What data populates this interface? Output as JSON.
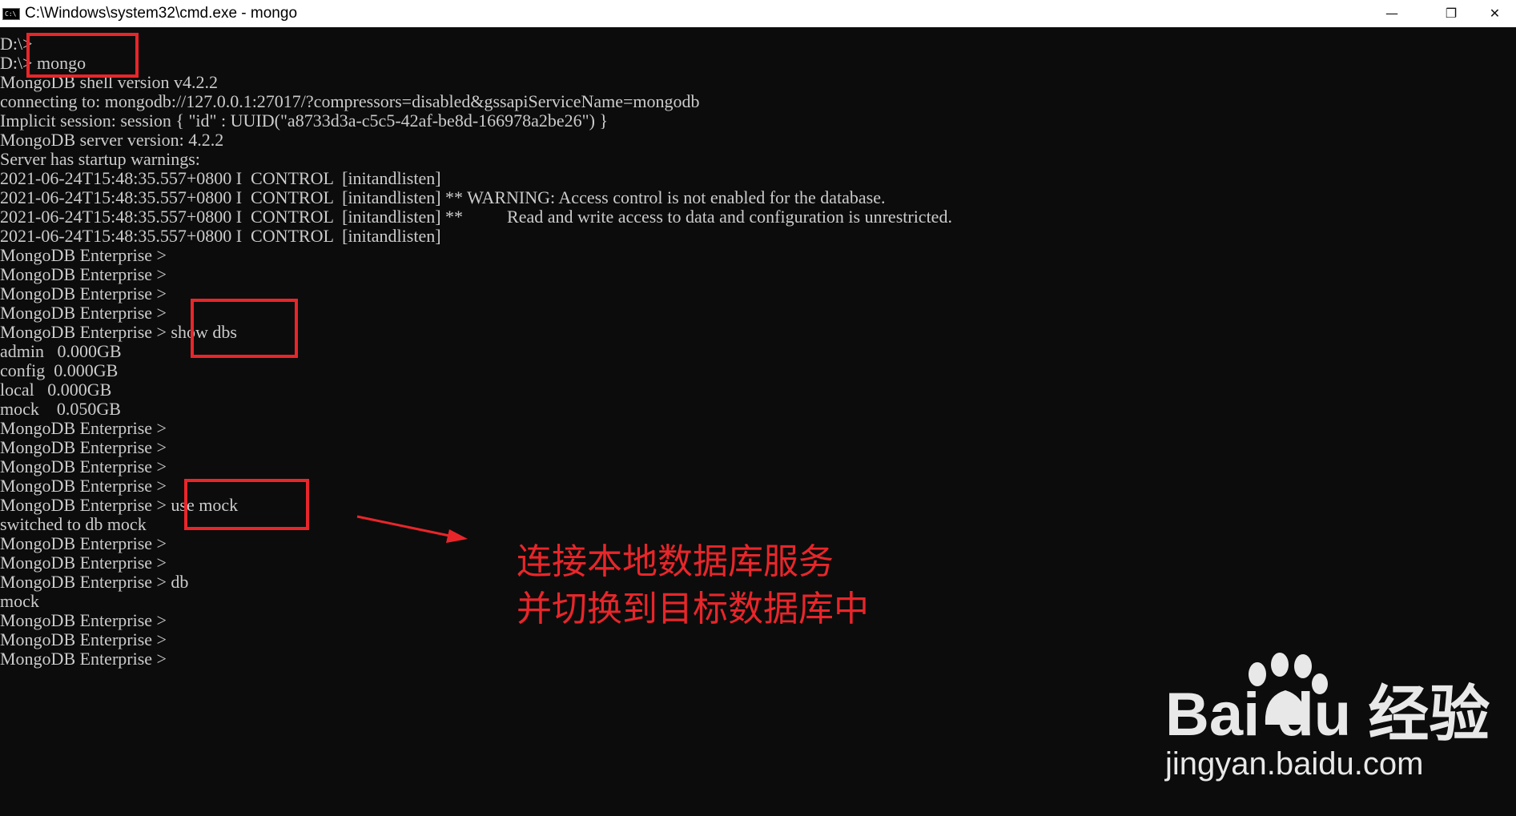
{
  "window": {
    "title": "C:\\Windows\\system32\\cmd.exe - mongo",
    "icon_text": "C:\\",
    "minimize_glyph": "—",
    "restore_glyph": "❐",
    "close_glyph": "✕"
  },
  "terminal": {
    "lines": [
      "D:\\>",
      "D:\\> mongo",
      "MongoDB shell version v4.2.2",
      "connecting to: mongodb://127.0.0.1:27017/?compressors=disabled&gssapiServiceName=mongodb",
      "Implicit session: session { \"id\" : UUID(\"a8733d3a-c5c5-42af-be8d-166978a2be26\") }",
      "MongoDB server version: 4.2.2",
      "Server has startup warnings:",
      "2021-06-24T15:48:35.557+0800 I  CONTROL  [initandlisten]",
      "2021-06-24T15:48:35.557+0800 I  CONTROL  [initandlisten] ** WARNING: Access control is not enabled for the database.",
      "2021-06-24T15:48:35.557+0800 I  CONTROL  [initandlisten] **          Read and write access to data and configuration is unrestricted.",
      "2021-06-24T15:48:35.557+0800 I  CONTROL  [initandlisten]",
      "MongoDB Enterprise >",
      "MongoDB Enterprise >",
      "MongoDB Enterprise >",
      "MongoDB Enterprise >",
      "MongoDB Enterprise > show dbs",
      "admin   0.000GB",
      "config  0.000GB",
      "local   0.000GB",
      "mock    0.050GB",
      "MongoDB Enterprise >",
      "MongoDB Enterprise >",
      "MongoDB Enterprise >",
      "MongoDB Enterprise >",
      "MongoDB Enterprise > use mock",
      "switched to db mock",
      "MongoDB Enterprise >",
      "MongoDB Enterprise >",
      "MongoDB Enterprise > db",
      "mock",
      "MongoDB Enterprise >",
      "MongoDB Enterprise >",
      "MongoDB Enterprise >"
    ]
  },
  "annotation": {
    "line1": "连接本地数据库服务",
    "line2": "并切换到目标数据库中",
    "color": "#e8262a"
  },
  "watermark": {
    "brand": "Bai du 经验",
    "url": "jingyan.baidu.com"
  },
  "colors": {
    "background": "#0c0c0c",
    "text": "#cccccc",
    "highlight": "#e8262a"
  }
}
